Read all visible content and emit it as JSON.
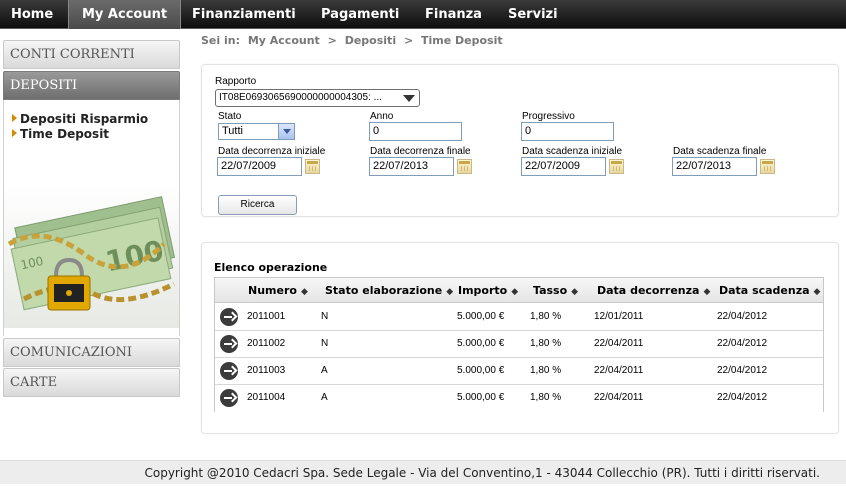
{
  "topnav": {
    "items": [
      {
        "label": "Home"
      },
      {
        "label": "My Account"
      },
      {
        "label": "Finanziamenti"
      },
      {
        "label": "Pagamenti"
      },
      {
        "label": "Finanza"
      },
      {
        "label": "Servizi"
      }
    ],
    "active": "My Account"
  },
  "sidebar": {
    "tabs": {
      "conti_correnti": "CONTI CORRENTI",
      "depositi": "DEPOSITI",
      "comunicazioni": "COMUNICAZIONI",
      "carte": "CARTE"
    },
    "links": [
      {
        "label": "Depositi Risparmio"
      },
      {
        "label": "Time Deposit"
      }
    ]
  },
  "breadcrumb": {
    "prefix": "Sei in:",
    "items": [
      "My Account",
      ">",
      "Depositi",
      ">",
      "Time Deposit"
    ]
  },
  "filters": {
    "rapporto_label": "Rapporto",
    "rapporto_value": "IT08E0693065690000000004305: ...",
    "stato_label": "Stato",
    "stato_value": "Tutti",
    "anno_label": "Anno",
    "anno_value": "0",
    "progressivo_label": "Progressivo",
    "progressivo_value": "0",
    "decorrenza_iniziale_label": "Data decorrenza iniziale",
    "decorrenza_iniziale_value": "22/07/2009",
    "decorrenza_finale_label": "Data decorrenza finale",
    "decorrenza_finale_value": "22/07/2013",
    "scadenza_iniziale_label": "Data scadenza iniziale",
    "scadenza_iniziale_value": "22/07/2009",
    "scadenza_finale_label": "Data scadenza finale",
    "scadenza_finale_value": "22/07/2013",
    "search_button": "Ricerca"
  },
  "operations": {
    "title": "Elenco operazione",
    "sort_glyph": "◆",
    "columns": [
      "Numero",
      "Stato elaborazione",
      "Importo",
      "Tasso",
      "Data decorrenza",
      "Data scadenza"
    ],
    "rows": [
      {
        "numero": "2011001",
        "stato": "N",
        "importo": "5.000,00 €",
        "tasso": "1,80 %",
        "decorrenza": "12/01/2011",
        "scadenza": "22/04/2012"
      },
      {
        "numero": "2011002",
        "stato": "N",
        "importo": "5.000,00 €",
        "tasso": "1,80 %",
        "decorrenza": "22/04/2011",
        "scadenza": "22/04/2012"
      },
      {
        "numero": "2011003",
        "stato": "A",
        "importo": "5.000,00 €",
        "tasso": "1,80 %",
        "decorrenza": "22/04/2011",
        "scadenza": "22/04/2012"
      },
      {
        "numero": "2011004",
        "stato": "A",
        "importo": "5.000,00 €",
        "tasso": "1,80 %",
        "decorrenza": "22/04/2011",
        "scadenza": "22/04/2012"
      }
    ]
  },
  "footer": {
    "text": "Copyright @2010 Cedacri Spa. Sede Legale - Via del Conventino,1 - 43044 Collecchio (PR). Tutti i diritti riservati."
  },
  "icons": {
    "calendar": "calendar-icon",
    "row_action": "arrow-right-circle-icon",
    "sidebar_bullet": "triangle-bullet-icon",
    "dropdown": "chevron-down-icon"
  },
  "colors": {
    "nav_bg": "#0e0e0e",
    "active_tab": "#6e6e6e",
    "bullet": "#d58a00",
    "footer_bg": "#ededed"
  }
}
